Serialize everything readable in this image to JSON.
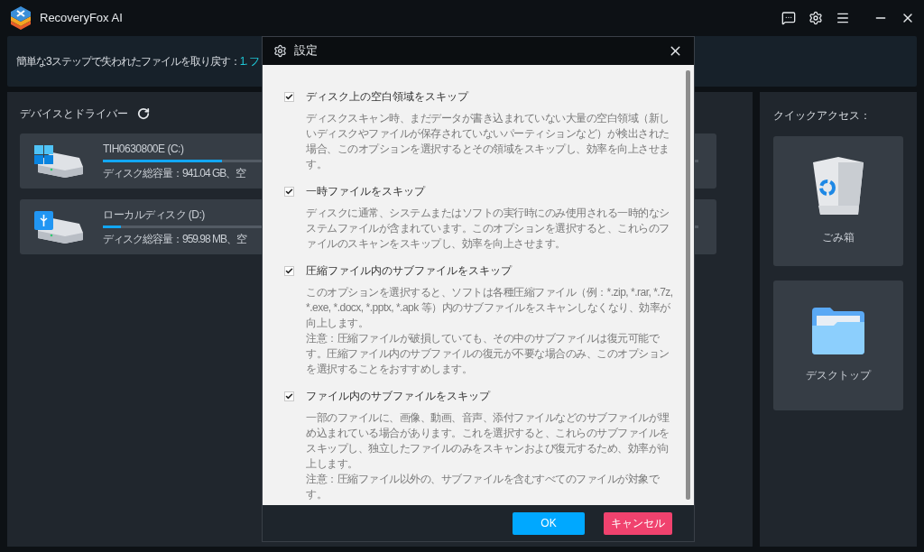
{
  "app": {
    "title": "RecoveryFox AI"
  },
  "banner": {
    "text": "簡単な3ステップで失われたファイルを取り戻す：",
    "step": "1. フ"
  },
  "devices": {
    "title": "デバイスとドライバー",
    "drives": [
      {
        "kind": "system",
        "name": "TIH0630800E (C:)",
        "level": 0.2,
        "info": "ディスク総容量：941.04 GB、空"
      },
      {
        "kind": "usb",
        "name": "ローカルディスク (D:)",
        "level": 0.03,
        "info": "ディスク総容量：959.98 MB、空"
      }
    ]
  },
  "quick_access": {
    "title": "クイックアクセス：",
    "items": [
      {
        "kind": "trash",
        "label": "ごみ箱"
      },
      {
        "kind": "folder",
        "label": "デスクトップ"
      }
    ]
  },
  "dialog": {
    "title": "設定",
    "options": [
      {
        "label": "ディスク上の空白領域をスキップ",
        "checked": true,
        "paragraphs": [
          "ディスクスキャン時、まだデータが書き込まれていない大量の空白領域（新しいディスクやファイルが保存されていないパーティションなど）が検出された場合、このオプションを選択するとその領域をスキップし、効率を向上させます。"
        ]
      },
      {
        "label": "一時ファイルをスキップ",
        "checked": true,
        "paragraphs": [
          "ディスクに通常、システムまたはソフトの実行時にのみ使用される一時的なシステムファイルが含まれています。このオプションを選択すると、これらのファイルのスキャンをスキップし、効率を向上させます。"
        ]
      },
      {
        "label": "圧縮ファイル内のサブファイルをスキップ",
        "checked": true,
        "paragraphs": [
          "このオプションを選択すると、ソフトは各種圧縮ファイル（例：*.zip, *.rar, *.7z, *.exe, *.docx, *.pptx, *.apk 等）内のサブファイルをスキャンしなくなり、効率が向上します。",
          "注意：圧縮ファイルが破損していても、その中のサブファイルは復元可能です。圧縮ファイル内のサブファイルの復元が不要な場合のみ、このオプションを選択することをおすすめします。"
        ]
      },
      {
        "label": "ファイル内のサブファイルをスキップ",
        "checked": true,
        "paragraphs": [
          "一部のファイルに、画像、動画、音声、添付ファイルなどのサブファイルが埋め込まれている場合があります。これを選択すると、これらのサブファイルをスキップし、独立したファイルのみをスキャンおよび復元するため、効率が向上します。",
          "注意：圧縮ファイル以外の、サブファイルを含むすべてのファイルが対象です。"
        ]
      }
    ],
    "buttons": [
      {
        "kind": "primary",
        "label": "OK"
      },
      {
        "kind": "danger",
        "label": "キャンセル"
      }
    ]
  }
}
